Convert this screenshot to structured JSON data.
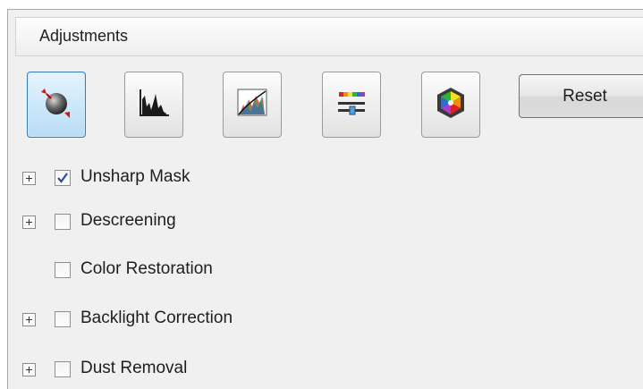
{
  "panel": {
    "title": "Adjustments"
  },
  "toolbar": {
    "buttons": [
      {
        "name": "unsharp-mask-tool",
        "icon": "sphere-pin-icon",
        "active": true
      },
      {
        "name": "histogram-tool",
        "icon": "histogram-icon",
        "active": false
      },
      {
        "name": "tone-curve-tool",
        "icon": "tone-curve-icon",
        "active": false
      },
      {
        "name": "image-adjustment-tool",
        "icon": "color-slider-icon",
        "active": false
      },
      {
        "name": "color-palette-tool",
        "icon": "color-wheel-icon",
        "active": false
      }
    ],
    "reset_label": "Reset"
  },
  "options": [
    {
      "label": "Unsharp Mask",
      "checked": true,
      "expandable": true
    },
    {
      "label": "Descreening",
      "checked": false,
      "expandable": true
    },
    {
      "label": "Color Restoration",
      "checked": false,
      "expandable": false
    },
    {
      "label": "Backlight Correction",
      "checked": false,
      "expandable": true
    },
    {
      "label": "Dust Removal",
      "checked": false,
      "expandable": true
    }
  ],
  "colors": {
    "active_button": "#b6dcf5",
    "panel_bg": "#f0f0f0",
    "check_mark": "#2c4d9e"
  }
}
